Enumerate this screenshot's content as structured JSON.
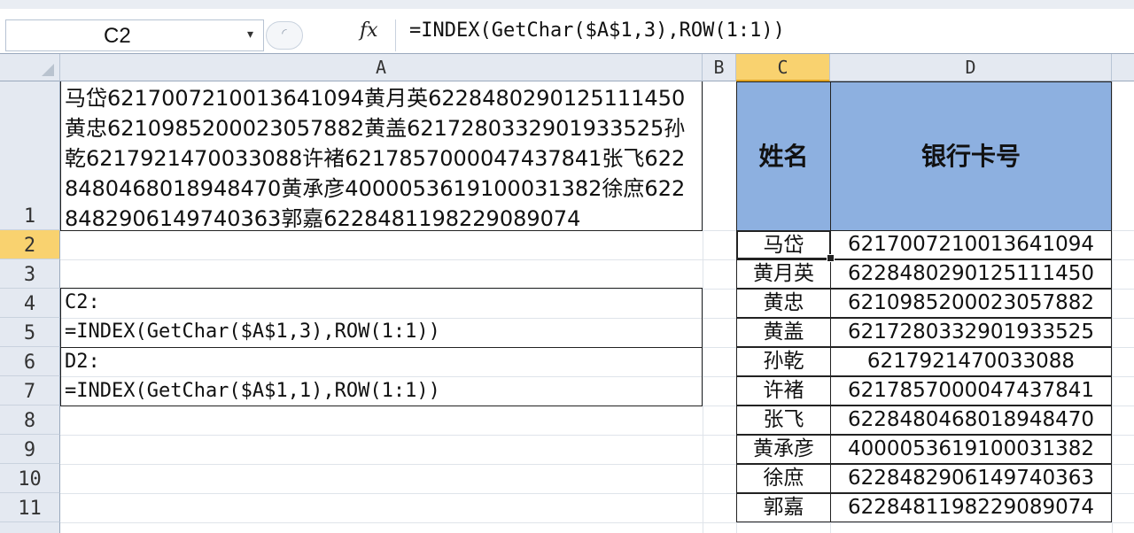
{
  "formula_bar": {
    "name_box": "C2",
    "dropdown_icon": "▾",
    "fx_label": "fx",
    "formula": "=INDEX(GetChar($A$1,3),ROW(1:1))"
  },
  "columns": [
    "A",
    "B",
    "C",
    "D"
  ],
  "selected_column": "C",
  "rows": [
    "1",
    "2",
    "3",
    "4",
    "5",
    "6",
    "7",
    "8",
    "9",
    "10",
    "11"
  ],
  "selected_row": "2",
  "cells": {
    "A1": "马岱6217007210013641094黄月英6228480290125111450黄忠6210985200023057882黄盖6217280332901933525孙乾6217921470033088许褚6217857000047437841张飞6228480468018948470黄承彦4000053619100031382徐庶6228482906149740363郭嘉6228481198229089074",
    "A4": "C2:",
    "A5": "=INDEX(GetChar($A$1,3),ROW(1:1))",
    "A6": "D2:",
    "A7": "=INDEX(GetChar($A$1,1),ROW(1:1))"
  },
  "table": {
    "header_name": "姓名",
    "header_card": "银行卡号",
    "header_color": "#8db0e0",
    "rows": [
      {
        "name": "马岱",
        "card": "6217007210013641094"
      },
      {
        "name": "黄月英",
        "card": "6228480290125111450"
      },
      {
        "name": "黄忠",
        "card": "6210985200023057882"
      },
      {
        "name": "黄盖",
        "card": "6217280332901933525"
      },
      {
        "name": "孙乾",
        "card": "6217921470033088"
      },
      {
        "name": "许褚",
        "card": "6217857000047437841"
      },
      {
        "name": "张飞",
        "card": "6228480468018948470"
      },
      {
        "name": "黄承彦",
        "card": "4000053619100031382"
      },
      {
        "name": "徐庶",
        "card": "6228482906149740363"
      },
      {
        "name": "郭嘉",
        "card": "6228481198229089074"
      }
    ]
  }
}
